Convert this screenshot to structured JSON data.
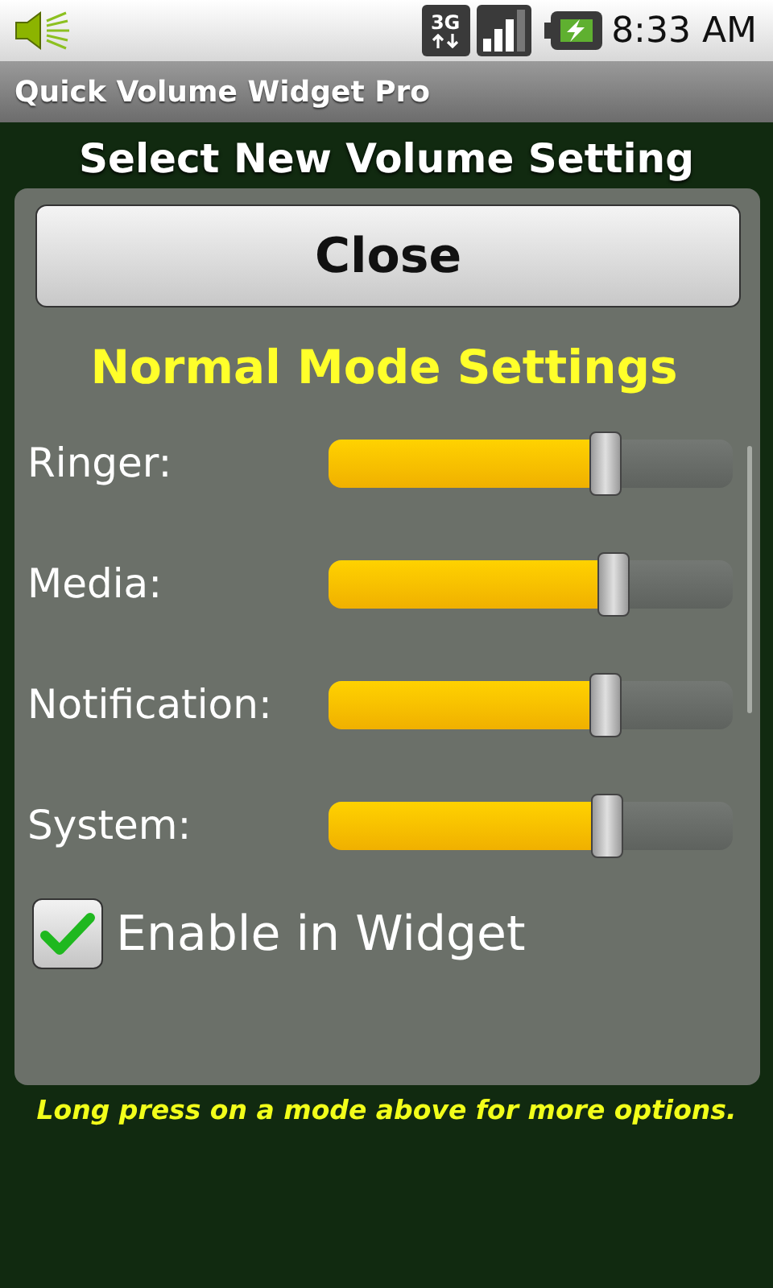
{
  "status_bar": {
    "network": "3G",
    "time": "8:33 AM"
  },
  "app_bar": {
    "title": "Quick Volume Widget Pro"
  },
  "screen_title": "Select New Volume Setting",
  "dialog": {
    "close_button": "Close",
    "heading": "Normal Mode Settings",
    "sliders": [
      {
        "label": "Ringer:",
        "level": 0.685
      },
      {
        "label": "Media:",
        "level": 0.705
      },
      {
        "label": "Notification:",
        "level": 0.685
      },
      {
        "label": "System:",
        "level": 0.69
      }
    ],
    "checkbox": {
      "label": "Enable in Widget",
      "checked": true
    }
  },
  "footer_hint": "Long press on a mode above for more options."
}
